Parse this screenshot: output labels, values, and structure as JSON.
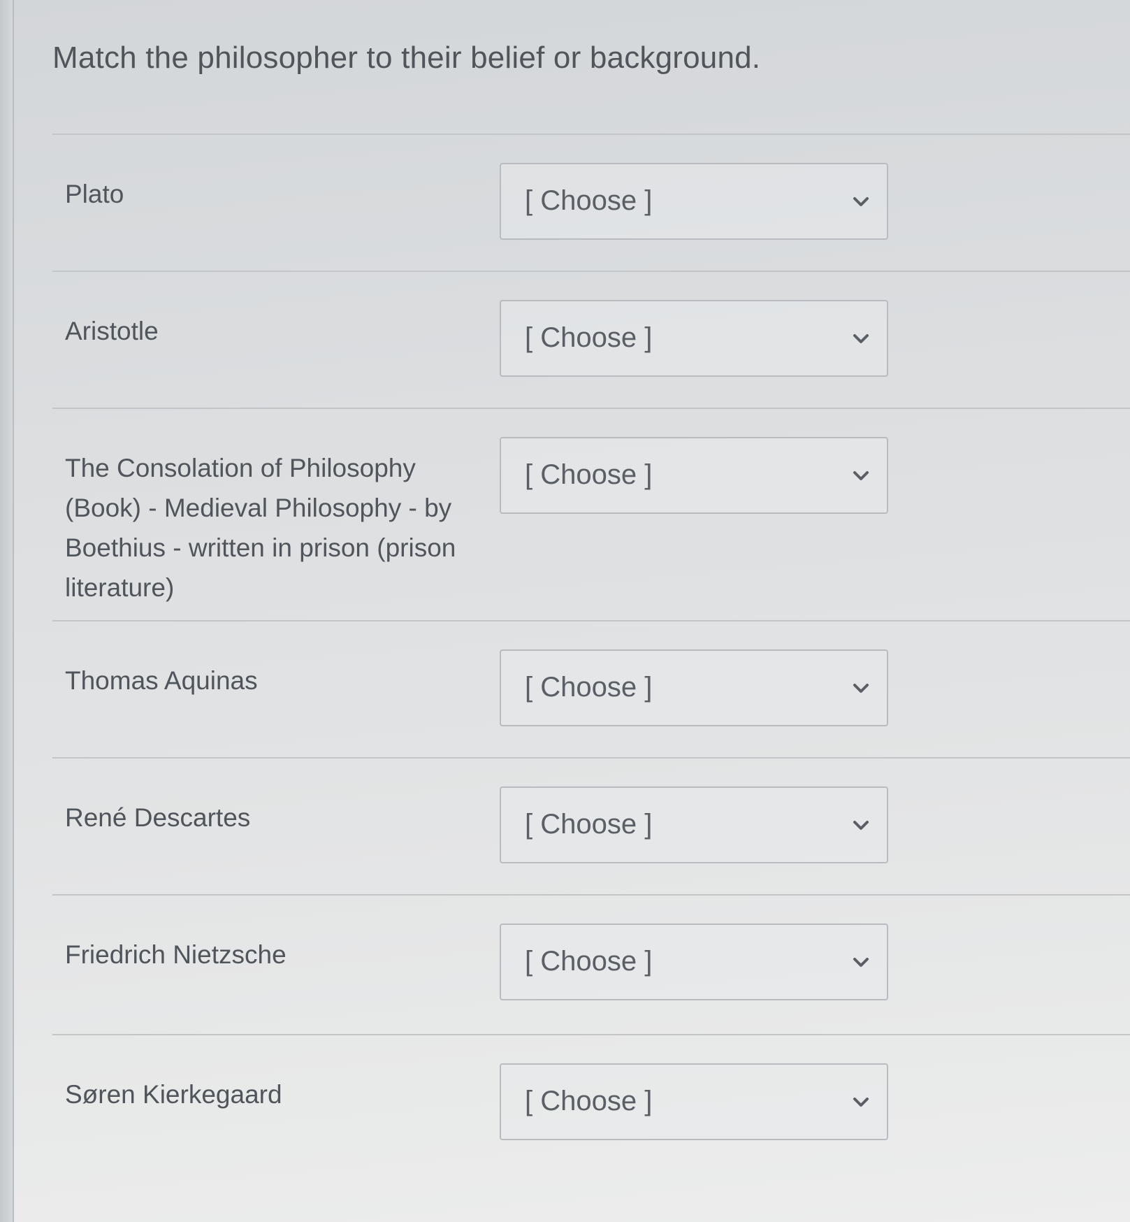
{
  "question": {
    "prompt": "Match the philosopher to their belief or background."
  },
  "rows": [
    {
      "label": "Plato",
      "select_value": "[ Choose ]"
    },
    {
      "label": "Aristotle",
      "select_value": "[ Choose ]"
    },
    {
      "label": "The Consolation of Philosophy (Book) - Medieval Philosophy - by Boethius - written in prison (prison literature)",
      "select_value": "[ Choose ]"
    },
    {
      "label": "Thomas Aquinas",
      "select_value": "[ Choose ]"
    },
    {
      "label": "René Descartes",
      "select_value": "[ Choose ]"
    },
    {
      "label": "Friedrich Nietzsche",
      "select_value": "[ Choose ]"
    },
    {
      "label": "Søren Kierkegaard",
      "select_value": "[ Choose ]"
    }
  ],
  "icons": {
    "dropdown": "chevron-down-icon"
  }
}
